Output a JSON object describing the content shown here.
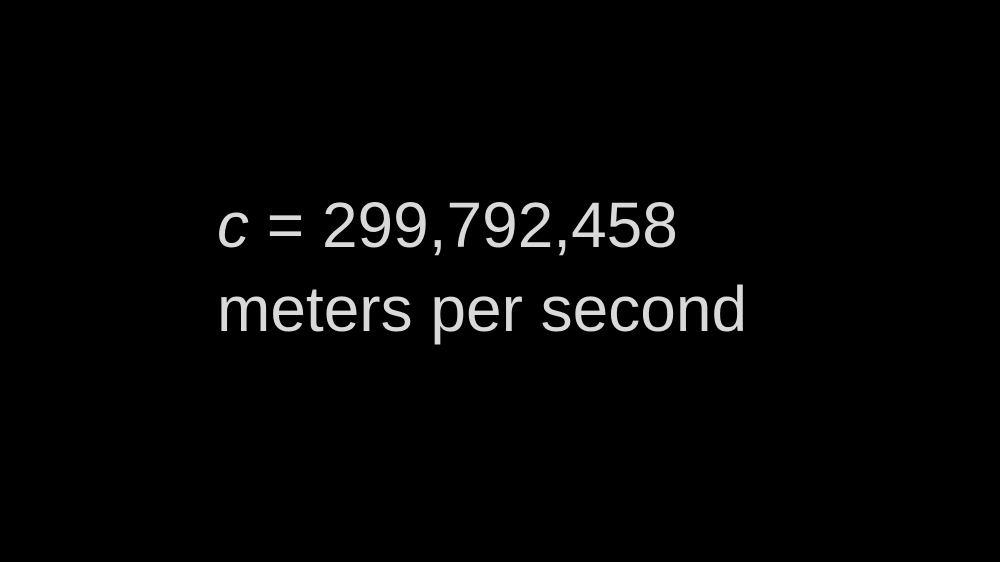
{
  "colors": {
    "background": "#000000",
    "text": "#d9d9d9"
  },
  "equation": {
    "variable": "c",
    "operator": "=",
    "value": "299,792,458",
    "unit_line": "meters per second"
  }
}
